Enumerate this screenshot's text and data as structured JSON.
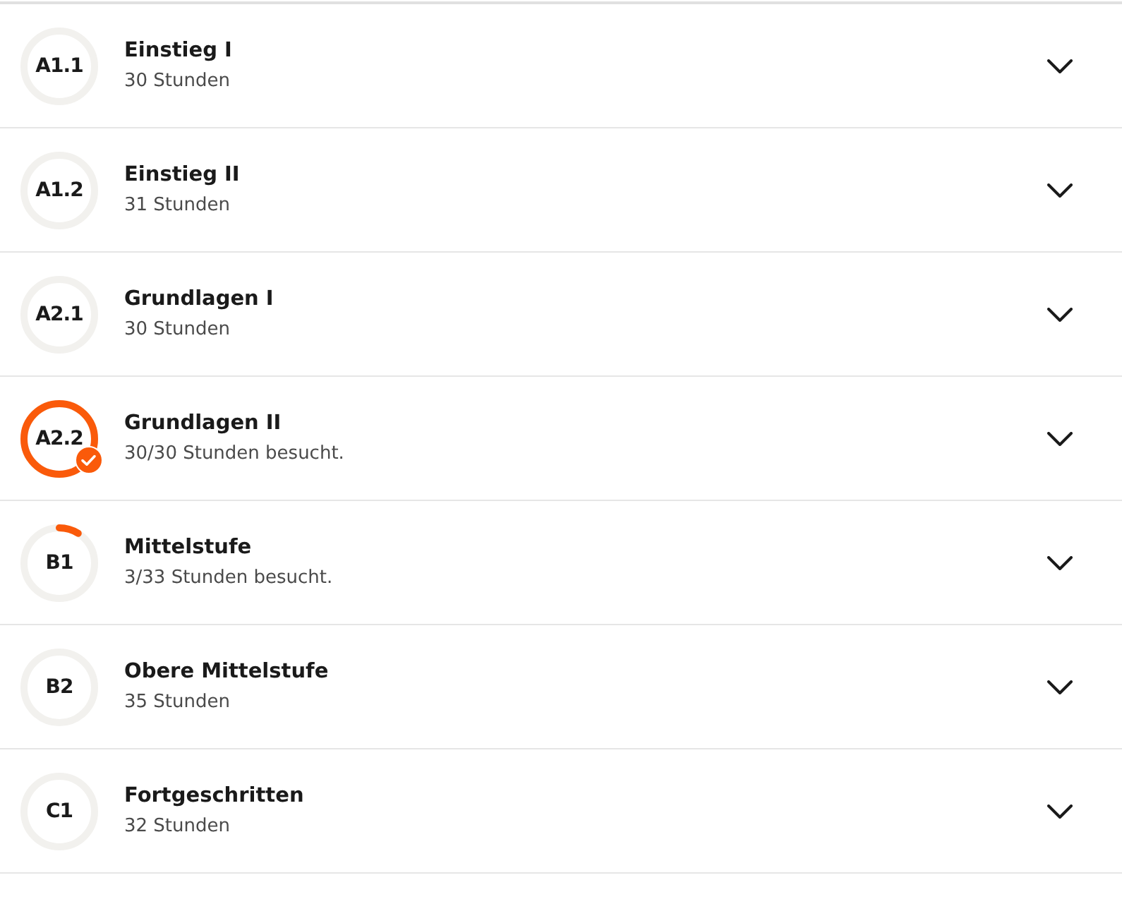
{
  "courses": [
    {
      "badge": "A1.1",
      "title": "Einstieg I",
      "hours": "30 Stunden",
      "level": 0,
      "completed": false
    },
    {
      "badge": "A1.2",
      "title": "Einstieg II",
      "hours": "31 Stunden",
      "level": 0,
      "completed": false
    },
    {
      "badge": "A2.1",
      "title": "Grundlagen I",
      "hours": "30 Stunden",
      "level": 0,
      "completed": false
    },
    {
      "badge": "A2.2",
      "title": "Grundlagen II",
      "hours": "30/30 Stunden besucht.",
      "completed": true
    },
    {
      "badge": "B1",
      "title": "Mittelstufe",
      "hours": "3/33 Stunden besucht.",
      "level": 0.09,
      "completed": false
    },
    {
      "badge": "B2",
      "title": "Obere Mittelstufe",
      "hours": "35 Stunden",
      "level": 0,
      "completed": false
    },
    {
      "badge": "C1",
      "title": "Fortgeschritten",
      "hours": "32 Stunden",
      "level": 0,
      "completed": false
    }
  ]
}
